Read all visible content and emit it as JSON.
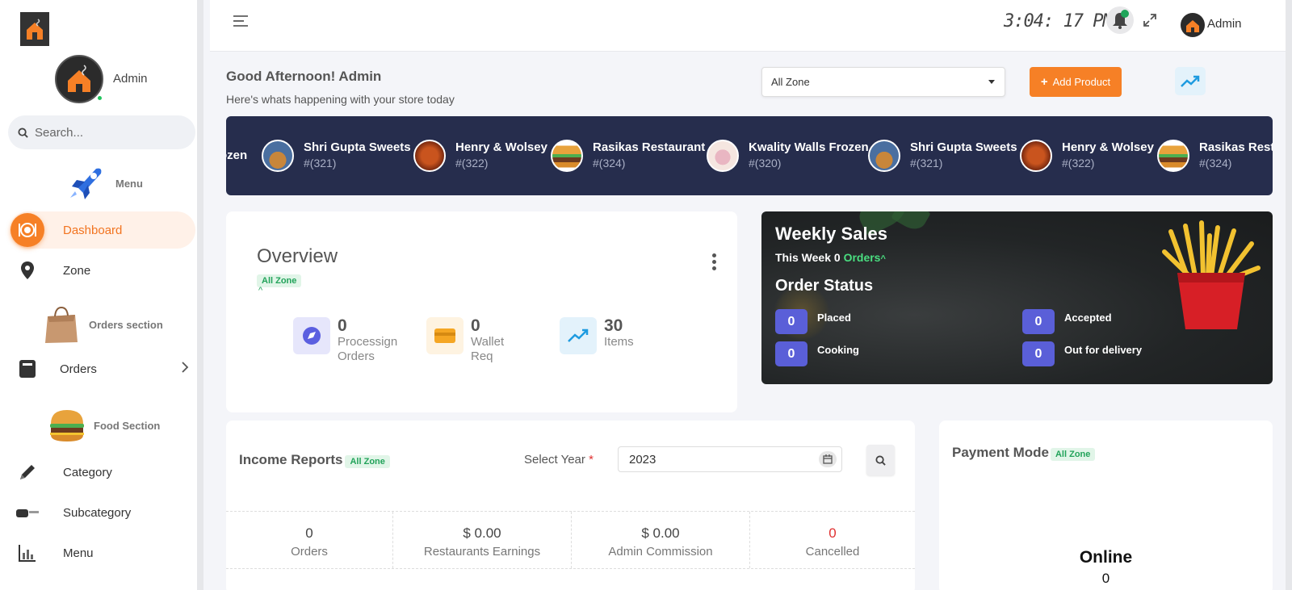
{
  "sidebar": {
    "admin_name": "Admin",
    "search_placeholder": "Search...",
    "sections": {
      "menu": "Menu",
      "orders": "Orders section",
      "food": "Food Section"
    },
    "items": [
      {
        "label": "Dashboard",
        "icon": "dashboard-icon",
        "active": true
      },
      {
        "label": "Zone",
        "icon": "map-pin-icon"
      },
      {
        "label": "Orders",
        "icon": "orders-icon"
      },
      {
        "label": "Category",
        "icon": "pencil-icon"
      },
      {
        "label": "Subcategory",
        "icon": "subcategory-icon"
      },
      {
        "label": "Menu",
        "icon": "bar-chart-icon"
      }
    ]
  },
  "header": {
    "clock": "3:04: 17 PM",
    "user": "Admin"
  },
  "greeting": {
    "title": "Good Afternoon! Admin",
    "subtitle": "Here's whats happening with your store today"
  },
  "zone_select": {
    "value": "All Zone"
  },
  "add_product_label": "Add Product",
  "ticker": [
    {
      "name": "ozen",
      "id": ""
    },
    {
      "name": "Shri Gupta Sweets",
      "id": "#(321)"
    },
    {
      "name": "Henry & Wolsey",
      "id": "#(322)"
    },
    {
      "name": "Rasikas Restaurant",
      "id": "#(324)"
    },
    {
      "name": "Kwality Walls Frozen",
      "id": "#(320)"
    },
    {
      "name": "Shri Gupta Sweets",
      "id": "#(321)"
    },
    {
      "name": "Henry & Wolsey",
      "id": "#(322)"
    },
    {
      "name": "Rasikas Resta",
      "id": "#(324)"
    }
  ],
  "overview": {
    "title": "Overview",
    "zone_badge": "All Zone",
    "caret": "^",
    "stats": [
      {
        "value": "0",
        "label1": "Processign",
        "label2": "Orders",
        "color": "#5b5fe0"
      },
      {
        "value": "0",
        "label1": "Wallet",
        "label2": "Req",
        "color": "#f5a623"
      },
      {
        "value": "30",
        "label1": "Items",
        "label2": "",
        "color": "#1e9be0"
      }
    ]
  },
  "weekly_sales": {
    "title": "Weekly Sales",
    "week_prefix": "This Week 0",
    "week_orders": "Orders",
    "caret": "^",
    "order_status_title": "Order Status",
    "statuses": [
      {
        "count": "0",
        "label": "Placed"
      },
      {
        "count": "0",
        "label": "Accepted"
      },
      {
        "count": "0",
        "label": "Cooking"
      },
      {
        "count": "0",
        "label": "Out for delivery"
      }
    ]
  },
  "income": {
    "title": "Income Reports",
    "zone_badge": "All Zone",
    "select_year_label": "Select Year",
    "required_mark": "*",
    "year": "2023",
    "cells": [
      {
        "value": "0",
        "label": "Orders",
        "color": "#444"
      },
      {
        "value": "$ 0.00",
        "label": "Restaurants Earnings",
        "color": "#444"
      },
      {
        "value": "$ 0.00",
        "label": "Admin Commission",
        "color": "#444"
      },
      {
        "value": "0",
        "label": "Cancelled",
        "color": "#e03131"
      }
    ]
  },
  "payment": {
    "title": "Payment Mode",
    "zone_badge": "All Zone",
    "online_label": "Online",
    "online_value": "0"
  }
}
